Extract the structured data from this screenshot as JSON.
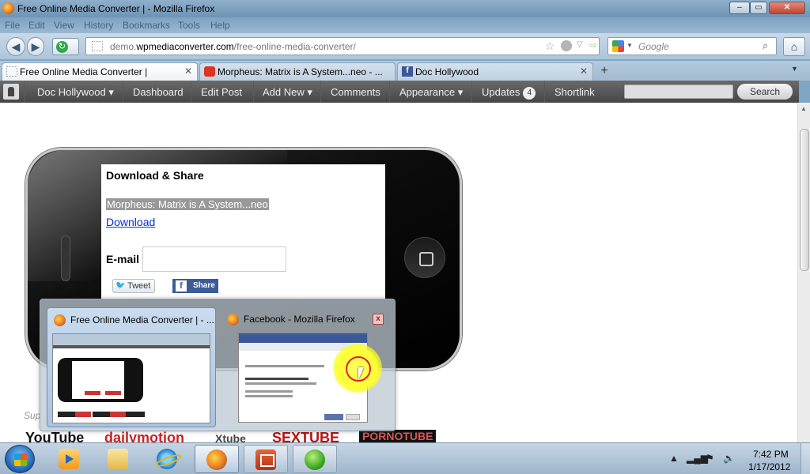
{
  "window": {
    "title": "Free Online Media Converter | - Mozilla Firefox",
    "controls": {
      "minimize": "–",
      "maximize": "▭",
      "close": "✕"
    }
  },
  "menu": [
    "File",
    "Edit",
    "View",
    "History",
    "Bookmarks",
    "Tools",
    "Help"
  ],
  "navbar": {
    "url_prefix": "demo.",
    "url_domain": "wpmediaconverter.com",
    "url_path": "/free-online-media-converter/",
    "search_placeholder": "Google"
  },
  "tabs": [
    {
      "label": "Free Online Media Converter |",
      "icon": "blank-page-icon",
      "active": true
    },
    {
      "label": "Morpheus: Matrix is A System...neo - ...",
      "icon": "youtube-icon",
      "active": false
    },
    {
      "label": "Doc Hollywood",
      "icon": "facebook-icon",
      "active": false
    }
  ],
  "adminbar": {
    "site": "Doc Hollywood",
    "dashboard": "Dashboard",
    "edit_post": "Edit Post",
    "add_new": "Add New",
    "comments": "Comments",
    "appearance": "Appearance",
    "updates": "Updates",
    "updates_count": "4",
    "shortlink": "Shortlink",
    "search_button": "Search"
  },
  "widget": {
    "heading": "Download & Share",
    "video_title": "Morpheus: Matrix is A System...neo",
    "download_link": "Download",
    "email_label": "E-mail",
    "tweet": "Tweet",
    "share": "Share",
    "fb_letter": "f"
  },
  "page_footer": {
    "support_text": "Sup",
    "logos": [
      "YouTube",
      "dailymotion",
      "Xtube",
      "SEXTUBE",
      "PORNOTUBE"
    ]
  },
  "preview": {
    "window1_title": "Free Online Media Converter | - ...",
    "window2_title": "Facebook - Mozilla Firefox",
    "close_glyph": "x"
  },
  "taskbar": {
    "apps": [
      "windows-media-player",
      "windows-explorer",
      "internet-explorer",
      "firefox",
      "powerpoint",
      "green-app"
    ],
    "time": "7:42 PM",
    "date": "1/17/2012"
  }
}
